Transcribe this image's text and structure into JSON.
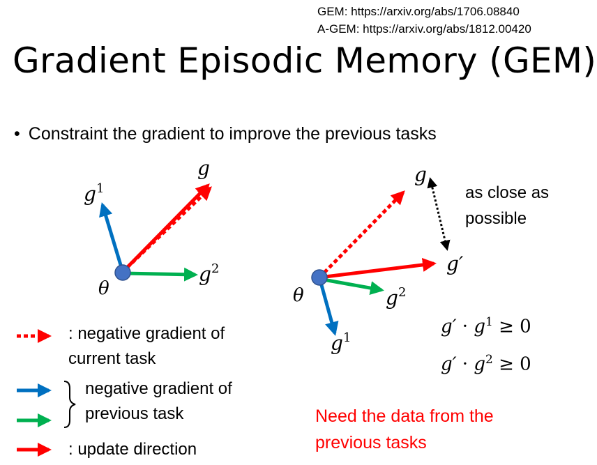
{
  "references": {
    "gem": "GEM: https://arxiv.org/abs/1706.08840",
    "agem": "A-GEM: https://arxiv.org/abs/1812.00420"
  },
  "title": "Gradient Episodic Memory (GEM)",
  "bullet": "Constraint the gradient to improve the previous tasks",
  "diagram_left": {
    "g_label": "g",
    "g1_base": "g",
    "g1_sup": "1",
    "g2_base": "g",
    "g2_sup": "2",
    "theta": "θ"
  },
  "diagram_right": {
    "g_label": "g",
    "gprime_label": "g′",
    "g1_base": "g",
    "g1_sup": "1",
    "g2_base": "g",
    "g2_sup": "2",
    "theta": "θ",
    "note": "as close as possible"
  },
  "equations": {
    "eq1": {
      "gp": "g′",
      "dot": " · ",
      "g": "g",
      "sup": "1",
      "rel": " ≥ 0"
    },
    "eq2": {
      "gp": "g′",
      "dot": " · ",
      "g": "g",
      "sup": "2",
      "rel": " ≥ 0"
    }
  },
  "legend": {
    "dashed_red": ": negative gradient of current task",
    "blue_green": "negative gradient of previous task",
    "solid_red": ": update direction"
  },
  "red_note": "Need the data from the previous tasks",
  "colors": {
    "red": "#ff0000",
    "blue": "#0070c0",
    "green": "#00b050",
    "theta_point": "#4472c4",
    "theta_outline": "#2f528f",
    "black": "#000000"
  }
}
